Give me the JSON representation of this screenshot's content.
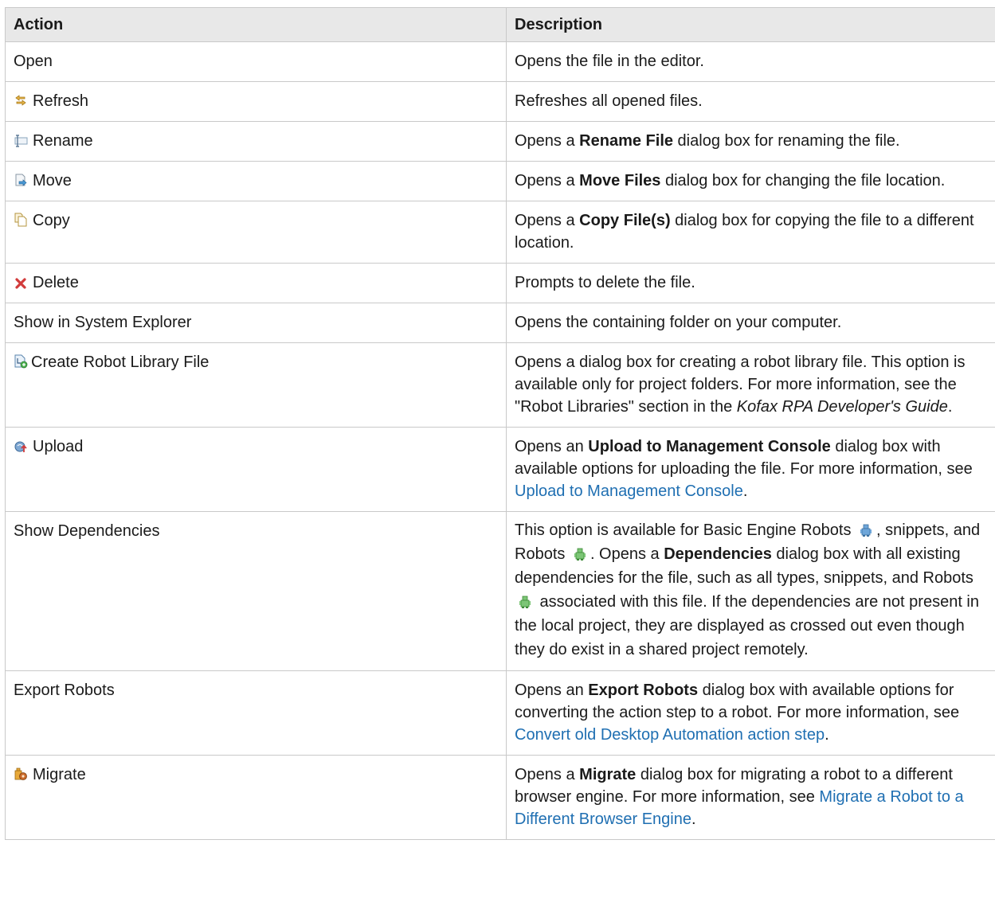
{
  "headers": {
    "action": "Action",
    "description": "Description"
  },
  "rows": [
    {
      "action": "Open",
      "desc": {
        "t1": "Opens the file in the editor."
      }
    },
    {
      "action": "Refresh",
      "icon": "refresh-icon",
      "desc": {
        "t1": "Refreshes all opened files."
      }
    },
    {
      "action": "Rename",
      "icon": "rename-icon",
      "desc": {
        "t1": "Opens a ",
        "b1": "Rename File",
        "t2": " dialog box for renaming the file."
      }
    },
    {
      "action": "Move",
      "icon": "move-icon",
      "desc": {
        "t1": "Opens a ",
        "b1": "Move Files",
        "t2": " dialog box for changing the file location."
      }
    },
    {
      "action": "Copy",
      "icon": "copy-icon",
      "desc": {
        "t1": "Opens a ",
        "b1": "Copy File(s)",
        "t2": " dialog box for copying the file to a different location."
      }
    },
    {
      "action": "Delete",
      "icon": "delete-icon",
      "desc": {
        "t1": "Prompts to delete the file."
      }
    },
    {
      "action": "Show in System Explorer",
      "desc": {
        "t1": "Opens the containing folder on your computer."
      }
    },
    {
      "action": "Create Robot Library File",
      "icon": "robot-library-file-icon",
      "desc": {
        "t1": "Opens a dialog box for creating a robot library file. This option is available only for project folders. For more information, see the \"Robot Libraries\" section in the ",
        "i1": "Kofax RPA Developer's Guide",
        "t2": "."
      }
    },
    {
      "action": "Upload",
      "icon": "upload-icon",
      "desc": {
        "t1": "Opens an ",
        "b1": "Upload to Management Console",
        "t2": " dialog box with available options for uploading the file. For more information, see ",
        "link": "Upload to Management Console",
        "t3": "."
      }
    },
    {
      "action": "Show Dependencies",
      "desc": {
        "t1": "This option is available for Basic Engine Robots ",
        "t2": ", snippets, and Robots ",
        "t3": ". Opens a ",
        "b1": "Dependencies",
        "t4": " dialog box with all existing dependencies for the file, such as all types, snippets, and Robots ",
        "t5": " associated with this file. If the dependencies are not present in the local project, they are displayed as crossed out even though they do exist in a shared project remotely."
      }
    },
    {
      "action": "Export Robots",
      "desc": {
        "t1": "Opens an ",
        "b1": "Export Robots",
        "t2": " dialog box with available options for converting the action step to a robot. For more information, see ",
        "link": "Convert old Desktop Automation action step",
        "t3": "."
      }
    },
    {
      "action": "Migrate",
      "icon": "migrate-icon",
      "desc": {
        "t1": "Opens a ",
        "b1": "Migrate",
        "t2": " dialog box for migrating a robot to a different browser engine. For more information, see ",
        "link": "Migrate a Robot to a Different Browser Engine",
        "t3": "."
      }
    }
  ],
  "colors": {
    "header_bg": "#e8e8e8",
    "border": "#c9c9c9",
    "link": "#1f6fb2"
  }
}
